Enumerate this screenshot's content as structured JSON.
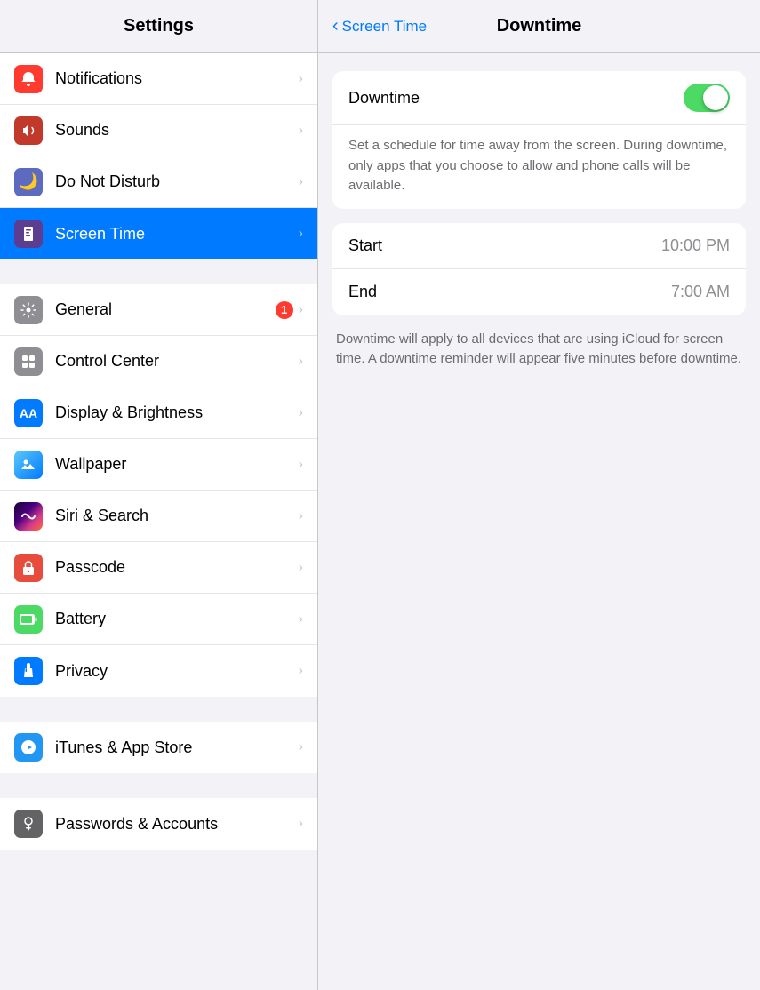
{
  "header": {
    "left_title": "Settings",
    "back_label": "Screen Time",
    "right_title": "Downtime"
  },
  "sidebar": {
    "groups": [
      {
        "items": [
          {
            "id": "notifications",
            "label": "Notifications",
            "icon_type": "notifications",
            "icon_color": "red",
            "selected": false
          },
          {
            "id": "sounds",
            "label": "Sounds",
            "icon_type": "sounds",
            "icon_color": "red-dark",
            "selected": false
          },
          {
            "id": "do-not-disturb",
            "label": "Do Not Disturb",
            "icon_type": "moon",
            "icon_color": "indigo",
            "selected": false
          },
          {
            "id": "screen-time",
            "label": "Screen Time",
            "icon_type": "hourglass",
            "icon_color": "purple",
            "selected": true
          }
        ]
      },
      {
        "items": [
          {
            "id": "general",
            "label": "General",
            "icon_type": "gear",
            "icon_color": "gray",
            "badge": "1",
            "selected": false
          },
          {
            "id": "control-center",
            "label": "Control Center",
            "icon_type": "switches",
            "icon_color": "gray",
            "selected": false
          },
          {
            "id": "display-brightness",
            "label": "Display & Brightness",
            "icon_type": "AA",
            "icon_color": "blue",
            "selected": false
          },
          {
            "id": "wallpaper",
            "label": "Wallpaper",
            "icon_type": "wallpaper",
            "icon_color": "teal",
            "selected": false
          },
          {
            "id": "siri-search",
            "label": "Siri & Search",
            "icon_type": "siri",
            "icon_color": "gradient-siri",
            "selected": false
          },
          {
            "id": "passcode",
            "label": "Passcode",
            "icon_type": "lock",
            "icon_color": "passcode",
            "selected": false
          },
          {
            "id": "battery",
            "label": "Battery",
            "icon_type": "battery",
            "icon_color": "battery-green",
            "selected": false
          },
          {
            "id": "privacy",
            "label": "Privacy",
            "icon_type": "hand",
            "icon_color": "blue-hand",
            "selected": false
          }
        ]
      },
      {
        "items": [
          {
            "id": "itunes-app-store",
            "label": "iTunes & App Store",
            "icon_type": "itunes",
            "icon_color": "itunes",
            "selected": false
          }
        ]
      },
      {
        "items": [
          {
            "id": "passwords-accounts",
            "label": "Passwords & Accounts",
            "icon_type": "key",
            "icon_color": "passwords",
            "selected": false
          }
        ]
      }
    ]
  },
  "downtime": {
    "title": "Downtime",
    "toggle_on": true,
    "description1": "Set a schedule for time away from the screen. During downtime, only apps that you choose to allow and phone calls will be available.",
    "start_label": "Start",
    "start_value": "10:00 PM",
    "end_label": "End",
    "end_value": "7:00 AM",
    "description2": "Downtime will apply to all devices that are using iCloud for screen time. A downtime reminder will appear five minutes before downtime."
  }
}
